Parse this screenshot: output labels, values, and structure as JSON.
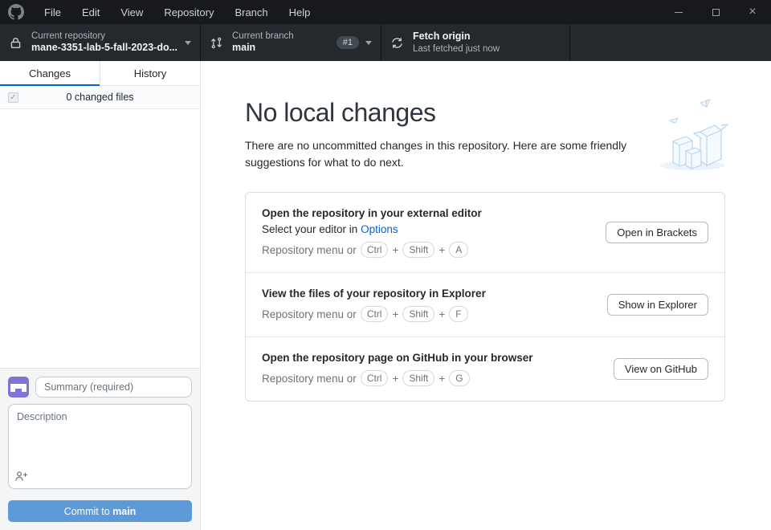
{
  "menu_bar": {
    "items": [
      "File",
      "Edit",
      "View",
      "Repository",
      "Branch",
      "Help"
    ]
  },
  "toolbar": {
    "repository": {
      "label": "Current repository",
      "value": "mane-3351-lab-5-fall-2023-do...",
      "icon": "lock-icon"
    },
    "branch": {
      "label": "Current branch",
      "value": "main",
      "badge": "#1",
      "icon": "branch-compare-icon"
    },
    "fetch": {
      "title": "Fetch origin",
      "subtitle": "Last fetched just now",
      "icon": "sync-icon"
    }
  },
  "sidebar": {
    "tabs": [
      {
        "label": "Changes",
        "active": true
      },
      {
        "label": "History",
        "active": false
      }
    ],
    "changes_summary": "0 changed files",
    "commit": {
      "summary_placeholder": "Summary (required)",
      "description_placeholder": "Description",
      "button_prefix": "Commit to ",
      "button_branch": "main"
    }
  },
  "main": {
    "title": "No local changes",
    "subtitle": "There are no uncommitted changes in this repository. Here are some friendly suggestions for what to do next.",
    "key_separator": "+",
    "suggestions": [
      {
        "title": "Open the repository in your external editor",
        "line2_prefix": "Select your editor in ",
        "line2_link": "Options",
        "shortcut_prefix": "Repository menu or",
        "keys": [
          "Ctrl",
          "Shift",
          "A"
        ],
        "button": "Open in Brackets"
      },
      {
        "title": "View the files of your repository in Explorer",
        "shortcut_prefix": "Repository menu or",
        "keys": [
          "Ctrl",
          "Shift",
          "F"
        ],
        "button": "Show in Explorer"
      },
      {
        "title": "Open the repository page on GitHub in your browser",
        "shortcut_prefix": "Repository menu or",
        "keys": [
          "Ctrl",
          "Shift",
          "G"
        ],
        "button": "View on GitHub"
      }
    ]
  },
  "colors": {
    "accent_blue": "#0366d6",
    "commit_button_blue": "#5d9ad7",
    "avatar_purple": "#7e74d4",
    "titlebar_bg": "#17191d",
    "toolbar_bg": "#24292e"
  }
}
